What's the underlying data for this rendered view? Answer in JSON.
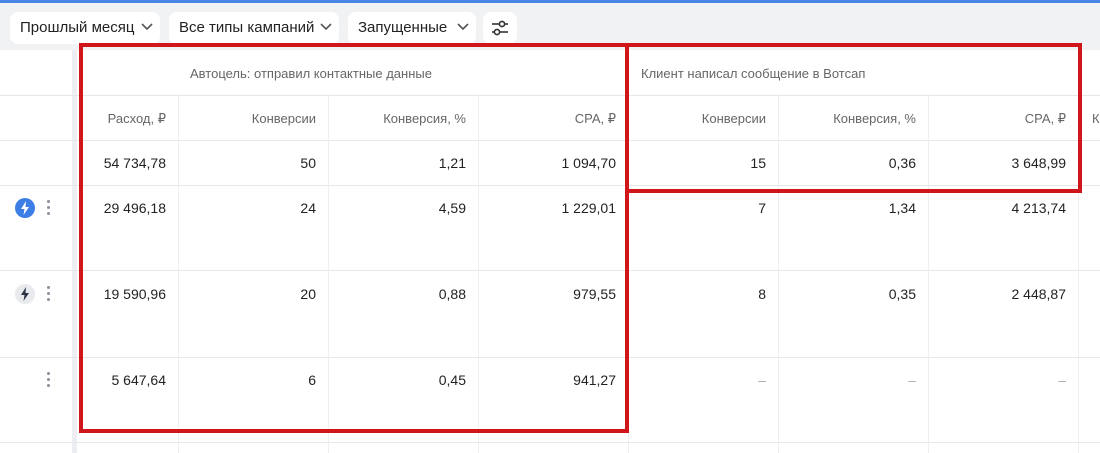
{
  "filters": {
    "period": "Прошлый месяц",
    "campaign_types": "Все типы кампаний",
    "status": "Запущенные",
    "settings_icon": "sliders-icon"
  },
  "groups": [
    {
      "label": "Автоцель: отправил контактные данные"
    },
    {
      "label": "Клиент написал сообщение в Вотсап"
    }
  ],
  "columns": {
    "spend": "Расход, ₽",
    "g1_conv": "Конверсии",
    "g1_rate": "Конверсия, %",
    "g1_cpa": "CPA, ₽",
    "g2_conv": "Конверсии",
    "g2_rate": "Конверсия, %",
    "g2_cpa": "CPA, ₽",
    "cut_off": "К"
  },
  "totals": {
    "spend": "54 734,78",
    "g1_conv": "50",
    "g1_rate": "1,21",
    "g1_cpa": "1 094,70",
    "g2_conv": "15",
    "g2_rate": "0,36",
    "g2_cpa": "3 648,99"
  },
  "rows": [
    {
      "icon": "lightning-icon",
      "icon_style": "blue",
      "spend": "29 496,18",
      "g1_conv": "24",
      "g1_rate": "4,59",
      "g1_cpa": "1 229,01",
      "g2_conv": "7",
      "g2_rate": "1,34",
      "g2_cpa": "4 213,74"
    },
    {
      "icon": "lightning-icon",
      "icon_style": "grey",
      "spend": "19 590,96",
      "g1_conv": "20",
      "g1_rate": "0,88",
      "g1_cpa": "979,55",
      "g2_conv": "8",
      "g2_rate": "0,35",
      "g2_cpa": "2 448,87"
    },
    {
      "icon": "",
      "icon_style": "none",
      "spend": "5 647,64",
      "g1_conv": "6",
      "g1_rate": "0,45",
      "g1_cpa": "941,27",
      "g2_conv": "–",
      "g2_rate": "–",
      "g2_cpa": "–"
    }
  ],
  "colors": {
    "highlight": "#d0161b",
    "accent": "#3d7de6"
  }
}
